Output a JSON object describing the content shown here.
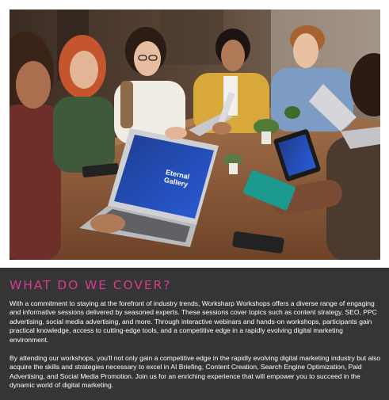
{
  "section": {
    "image_alt": "People working on laptops around a wooden table at a workshop",
    "heading": "WHAT DO WE COVER?",
    "paragraphs": [
      "With a commitment to staying at the forefront of industry trends, Worksharp Workshops offers a diverse range of engaging and informative sessions delivered by seasoned experts. These sessions cover topics such as content strategy, SEO, PPC advertising, social media advertising, and more. Through interactive webinars and hands-on workshops, participants gain practical knowledge, access to cutting-edge tools, and a competitive edge in a rapidly evolving digital marketing environment.",
      "By attending our workshops, you'll not only gain a competitive edge in the rapidly evolving digital marketing industry but also acquire the skills and strategies necessary to excel in AI Briefing, Content Creation, Search Engine Optimization, Paid Advertising, and Social Media Promotion. Join us for an enriching experience that will empower you to succeed in the dynamic world of digital marketing."
    ],
    "laptop_screen_text": "Eternal\nGallery"
  },
  "colors": {
    "panel_background": "#353535",
    "heading": "#d83a8e",
    "body_text": "#ffffff",
    "table_wood": "#8a5a3a"
  }
}
